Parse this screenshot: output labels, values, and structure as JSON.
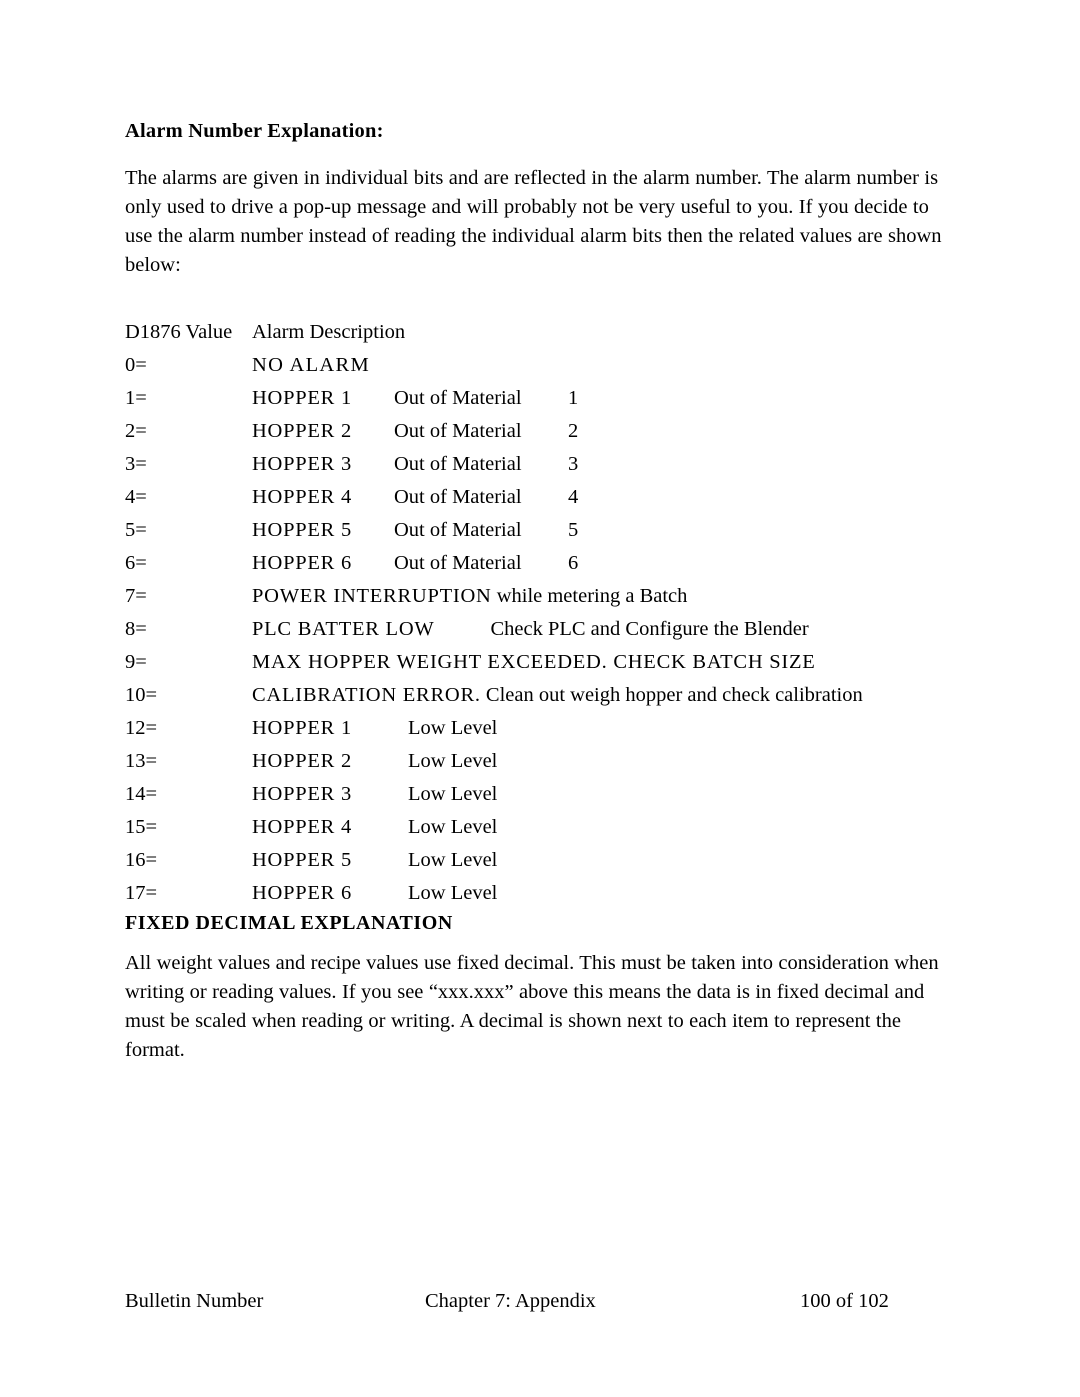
{
  "document": {
    "section_heading": "Alarm Number Explanation:",
    "intro_paragraph": "The alarms are given in individual bits and are reflected in the alarm number.  The alarm number is only used to drive a pop-up message and will probably not be very useful to you.  If you decide to use the alarm number instead of reading the individual alarm bits then the related values are shown below:",
    "table": {
      "header": {
        "value_column": "D1876 Value",
        "description_column": "Alarm Description"
      },
      "rows": [
        {
          "value": "0=",
          "name": "NO ALARM",
          "detail": "",
          "num": ""
        },
        {
          "value": "1=",
          "name": "HOPPER 1",
          "detail": "Out of Material",
          "num": "1"
        },
        {
          "value": "2=",
          "name": "HOPPER 2",
          "detail": "Out of Material",
          "num": "2"
        },
        {
          "value": "3=",
          "name": "HOPPER 3",
          "detail": "Out of Material",
          "num": "3"
        },
        {
          "value": "4=",
          "name": "HOPPER 4",
          "detail": "Out of Material",
          "num": "4"
        },
        {
          "value": "5=",
          "name": "HOPPER 5",
          "detail": "Out of Material",
          "num": "5"
        },
        {
          "value": "6=",
          "name": "HOPPER 6",
          "detail": "Out of Material",
          "num": "6"
        },
        {
          "value": "12=",
          "name": "HOPPER 1",
          "detail": "Low Level",
          "num": ""
        },
        {
          "value": "13=",
          "name": "HOPPER 2",
          "detail": "Low Level",
          "num": ""
        },
        {
          "value": "14=",
          "name": "HOPPER 3",
          "detail": "Low Level",
          "num": ""
        },
        {
          "value": "15=",
          "name": "HOPPER 4",
          "detail": "Low Level",
          "num": ""
        },
        {
          "value": "16=",
          "name": "HOPPER 5",
          "detail": "Low Level",
          "num": ""
        },
        {
          "value": "17=",
          "name": "HOPPER 6",
          "detail": "Low Level",
          "num": ""
        }
      ],
      "span_rows": {
        "row7_value": "7=",
        "row7_caps": "POWER INTERRUPTION",
        "row7_rest": " while metering a Batch",
        "row8_value": "8=",
        "row8_caps": "PLC BATTER LOW",
        "row8_rest": "Check PLC and Configure the Blender",
        "row9_value": "9=",
        "row9_caps": "MAX HOPPER WEIGHT EXCEEDED.  CHECK BATCH SIZE",
        "row10_value": "10=",
        "row10_caps": "CALIBRATION ERROR.",
        "row10_rest": "  Clean out weigh hopper and check calibration"
      }
    },
    "fixed_decimal_heading": "FIXED DECIMAL EXPLANATION",
    "fixed_decimal_paragraph": "All weight values and recipe values use fixed decimal.  This must be taken into consideration when writing or reading values.  If you see “xxx.xxx” above this means the data is in fixed decimal and must be scaled when reading or writing.  A decimal is shown next to each item to represent the format."
  },
  "footer": {
    "left": "Bulletin Number",
    "center": "Chapter 7: Appendix",
    "right": "100 of 102"
  }
}
